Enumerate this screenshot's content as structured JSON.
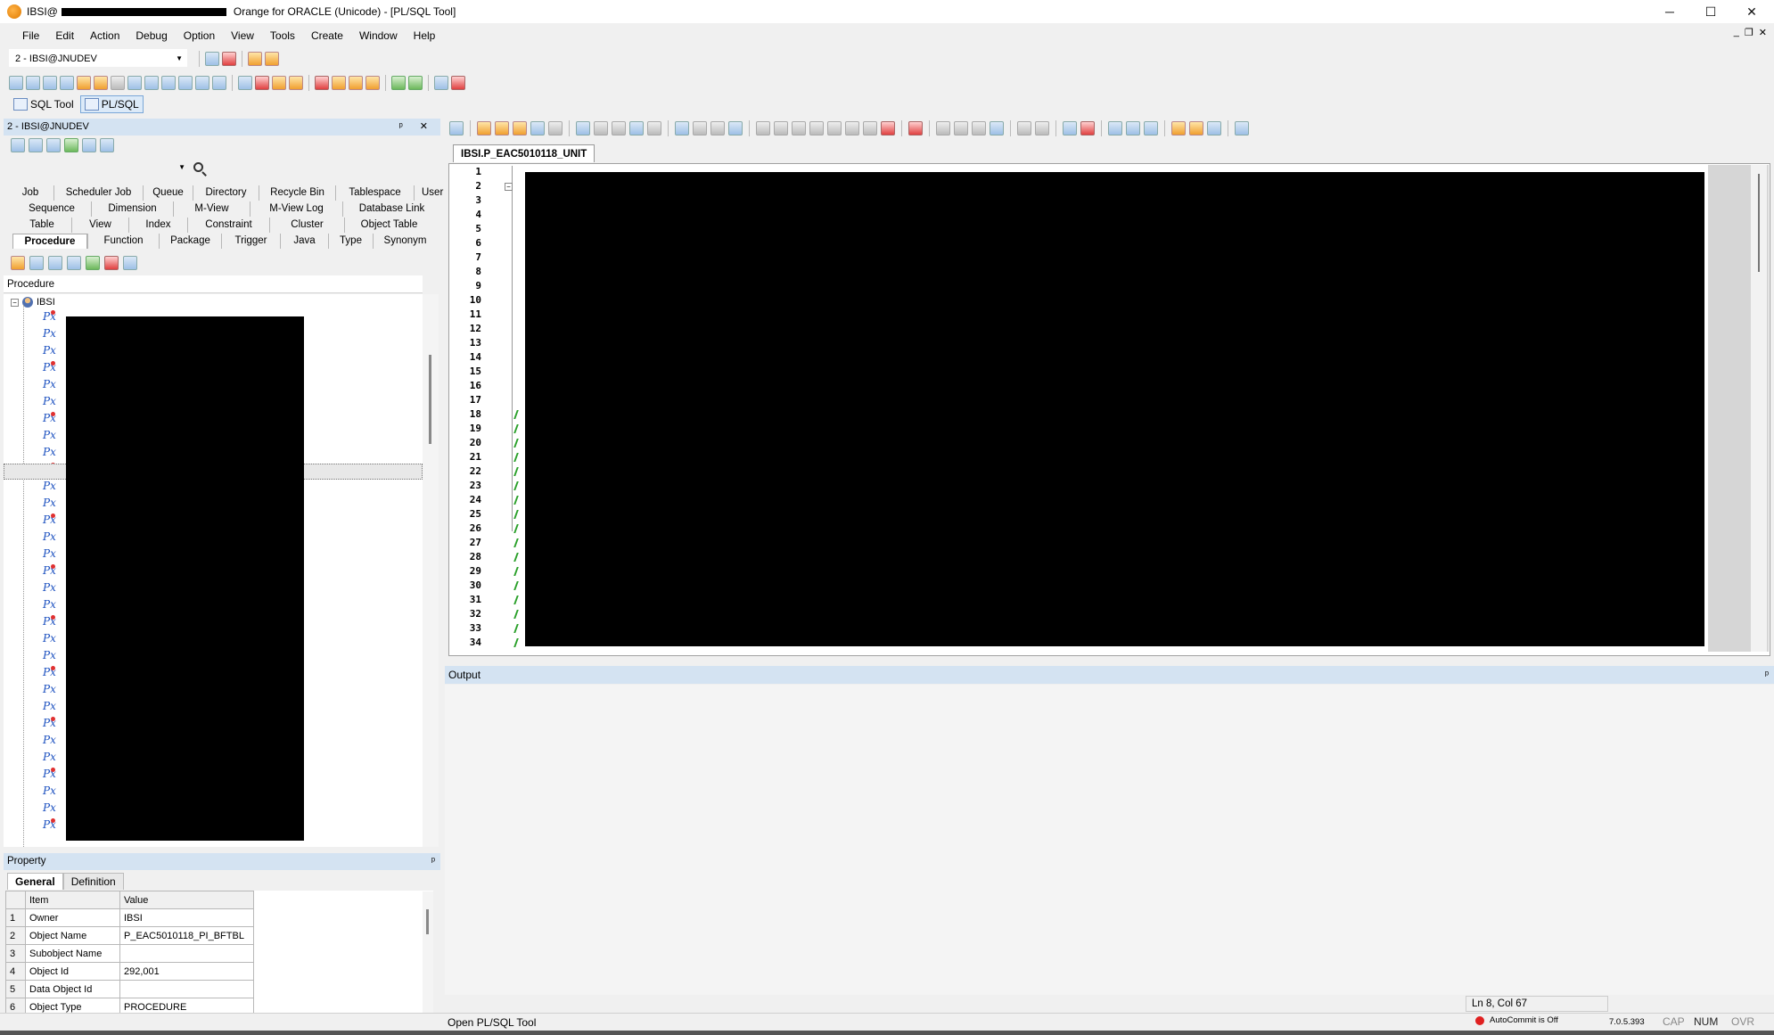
{
  "window": {
    "title_prefix": "IBSI@",
    "title_suffix": "Orange for ORACLE (Unicode) - [PL/SQL Tool]",
    "controls": {
      "minimize": "─",
      "maximize": "☐",
      "close": "✕"
    },
    "mdi_controls": {
      "minimize": "_",
      "restore": "❐",
      "close": "✕"
    }
  },
  "menu": [
    "File",
    "Edit",
    "Action",
    "Debug",
    "Option",
    "View",
    "Tools",
    "Create",
    "Window",
    "Help"
  ],
  "connection": {
    "selected": "2 - IBSI@JNUDEV"
  },
  "mode_tabs": [
    {
      "label": "SQL Tool",
      "active": false
    },
    {
      "label": "PL/SQL",
      "active": true
    }
  ],
  "left_panel": {
    "title": "2 - IBSI@JNUDEV",
    "controls": "ᵖ ✕",
    "object_tabs_rows": [
      [
        "Job",
        "Scheduler Job",
        "Queue",
        "Directory",
        "Recycle Bin",
        "Tablespace",
        "User"
      ],
      [
        "Sequence",
        "Dimension",
        "M-View",
        "M-View Log",
        "Database Link"
      ],
      [
        "Table",
        "View",
        "Index",
        "Constraint",
        "Cluster",
        "Object Table"
      ],
      [
        "Procedure",
        "Function",
        "Package",
        "Trigger",
        "Java",
        "Type",
        "Synonym"
      ]
    ],
    "selected_object_tab": "Procedure",
    "list_header": "Procedure",
    "tree_root": "IBSI",
    "tree_expander": "−"
  },
  "property_panel": {
    "title": "Property",
    "pin": "ᵖ",
    "tabs": [
      "General",
      "Definition"
    ],
    "selected_tab": "General",
    "columns": [
      "Item",
      "Value"
    ],
    "rows": [
      {
        "n": "1",
        "item": "Owner",
        "value": "IBSI"
      },
      {
        "n": "2",
        "item": "Object Name",
        "value": "P_EAC5010118_PI_BFTBL"
      },
      {
        "n": "3",
        "item": "Subobject Name",
        "value": ""
      },
      {
        "n": "4",
        "item": "Object Id",
        "value": "292,001"
      },
      {
        "n": "5",
        "item": "Data Object Id",
        "value": ""
      },
      {
        "n": "6",
        "item": "Object Type",
        "value": "PROCEDURE"
      }
    ]
  },
  "editor": {
    "doc_tab": "IBSI.P_EAC5010118_UNIT",
    "line_numbers": [
      "1",
      "2",
      "3",
      "4",
      "5",
      "6",
      "7",
      "8",
      "9",
      "10",
      "11",
      "12",
      "13",
      "14",
      "15",
      "16",
      "17",
      "18",
      "19",
      "20",
      "21",
      "22",
      "23",
      "24",
      "25",
      "26",
      "27",
      "28",
      "29",
      "30",
      "31",
      "32",
      "33",
      "34"
    ]
  },
  "output": {
    "title": "Output",
    "pin": "ᵖ"
  },
  "status": {
    "cursor": "Ln 8, Col 67",
    "message": "Open PL/SQL Tool",
    "autocommit": "AutoCommit is Off",
    "version": "7.0.5.393",
    "caps": "CAP",
    "num": "NUM",
    "ovr": "OVR"
  },
  "colors": {
    "panel_header": "#d4e3f2",
    "accent": "#7aa7d8",
    "redaction": "#000000",
    "autocommit_led": "#e02020"
  }
}
